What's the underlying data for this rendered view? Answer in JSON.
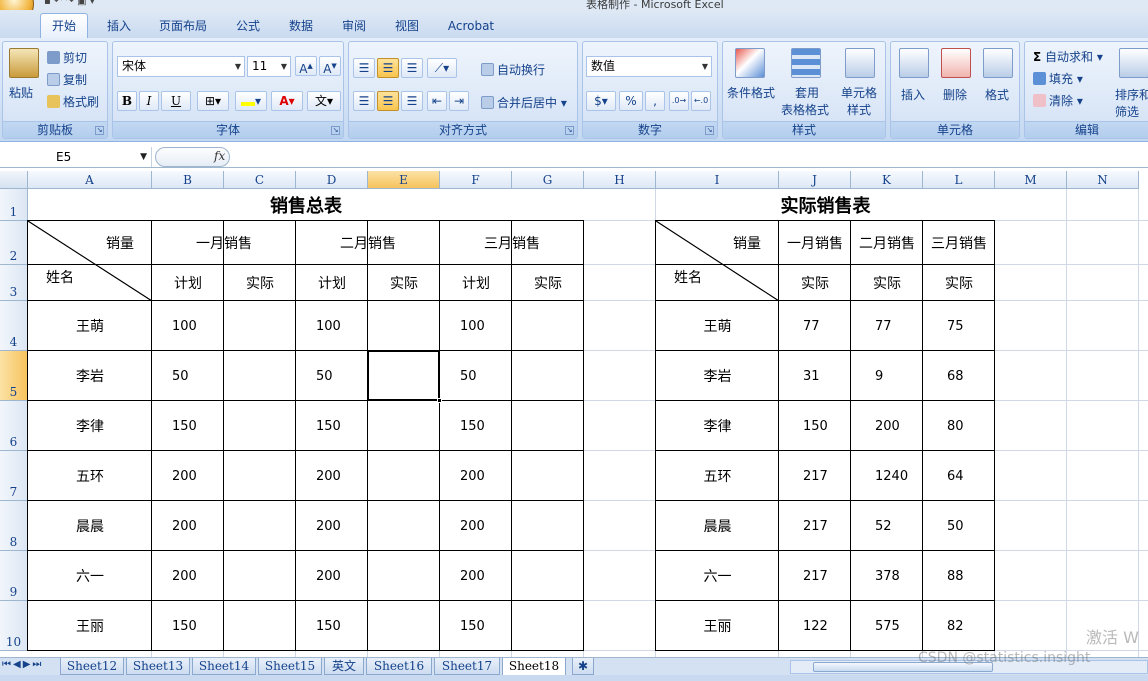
{
  "window": {
    "title": "表格制作 - Microsoft Excel"
  },
  "tabs": [
    "开始",
    "插入",
    "页面布局",
    "公式",
    "数据",
    "审阅",
    "视图",
    "Acrobat"
  ],
  "ribbon": {
    "clipboard": {
      "label": "剪贴板",
      "paste": "粘贴",
      "cut": "剪切",
      "copy": "复制",
      "format_painter": "格式刷"
    },
    "font": {
      "label": "字体",
      "font_name": "宋体",
      "font_size": "11",
      "bold": "B",
      "italic": "I",
      "underline": "U"
    },
    "alignment": {
      "label": "对齐方式",
      "wrap_text": "自动换行",
      "merge_center": "合并后居中"
    },
    "number": {
      "label": "数字",
      "format": "数值",
      "percent": "%",
      "comma": ","
    },
    "styles": {
      "label": "样式",
      "conditional": "条件格式",
      "table_format_1": "套用",
      "table_format_2": "表格格式",
      "cell_styles_1": "单元格",
      "cell_styles_2": "样式"
    },
    "cells": {
      "label": "单元格",
      "insert": "插入",
      "delete": "删除",
      "format": "格式"
    },
    "editing": {
      "label": "编辑",
      "autosum": "自动求和",
      "fill": "填充",
      "clear": "清除",
      "sort_1": "排序和",
      "sort_2": "筛选"
    }
  },
  "formula_bar": {
    "name_box": "E5",
    "fx": "fx",
    "value": ""
  },
  "columns": [
    "A",
    "B",
    "C",
    "D",
    "E",
    "F",
    "G",
    "H",
    "I",
    "J",
    "K",
    "L",
    "M",
    "N"
  ],
  "rows": [
    "1",
    "2",
    "3",
    "4",
    "5",
    "6",
    "7",
    "8",
    "9",
    "10"
  ],
  "left_table": {
    "title": "销售总表",
    "header_sales": "销量",
    "header_name": "姓名",
    "months": [
      "一月销售",
      "二月销售",
      "三月销售"
    ],
    "sub": [
      "计划",
      "实际",
      "计划",
      "实际",
      "计划",
      "实际"
    ],
    "rows": [
      {
        "name": "王萌",
        "plan": [
          "100",
          "100",
          "100"
        ]
      },
      {
        "name": "李岩",
        "plan": [
          "50",
          "50",
          "50"
        ]
      },
      {
        "name": "李律",
        "plan": [
          "150",
          "150",
          "150"
        ]
      },
      {
        "name": "五环",
        "plan": [
          "200",
          "200",
          "200"
        ]
      },
      {
        "name": "晨晨",
        "plan": [
          "200",
          "200",
          "200"
        ]
      },
      {
        "name": "六一",
        "plan": [
          "200",
          "200",
          "200"
        ]
      },
      {
        "name": "王丽",
        "plan": [
          "150",
          "150",
          "150"
        ]
      }
    ]
  },
  "right_table": {
    "title": "实际销售表",
    "header_sales": "销量",
    "header_name": "姓名",
    "months": [
      "一月销售",
      "二月销售",
      "三月销售"
    ],
    "sub": [
      "实际",
      "实际",
      "实际"
    ],
    "rows": [
      {
        "name": "王萌",
        "actual": [
          "77",
          "77",
          "75"
        ]
      },
      {
        "name": "李岩",
        "actual": [
          "31",
          "9",
          "68"
        ]
      },
      {
        "name": "李律",
        "actual": [
          "150",
          "200",
          "80"
        ]
      },
      {
        "name": "五环",
        "actual": [
          "217",
          "1240",
          "64"
        ]
      },
      {
        "name": "晨晨",
        "actual": [
          "217",
          "52",
          "50"
        ]
      },
      {
        "name": "六一",
        "actual": [
          "217",
          "378",
          "88"
        ]
      },
      {
        "name": "王丽",
        "actual": [
          "122",
          "575",
          "82"
        ]
      }
    ]
  },
  "sheet_tabs": [
    "Sheet12",
    "Sheet13",
    "Sheet14",
    "Sheet15",
    "英文",
    "Sheet16",
    "Sheet17",
    "Sheet18"
  ],
  "active_sheet": "Sheet18",
  "watermark": {
    "line1": "激活 W",
    "line2": "CSDN @statistics.insight"
  },
  "colors": {
    "accent": "#15428b",
    "ribbon": "#d3e2f5",
    "selected_header": "#f7c35d"
  }
}
